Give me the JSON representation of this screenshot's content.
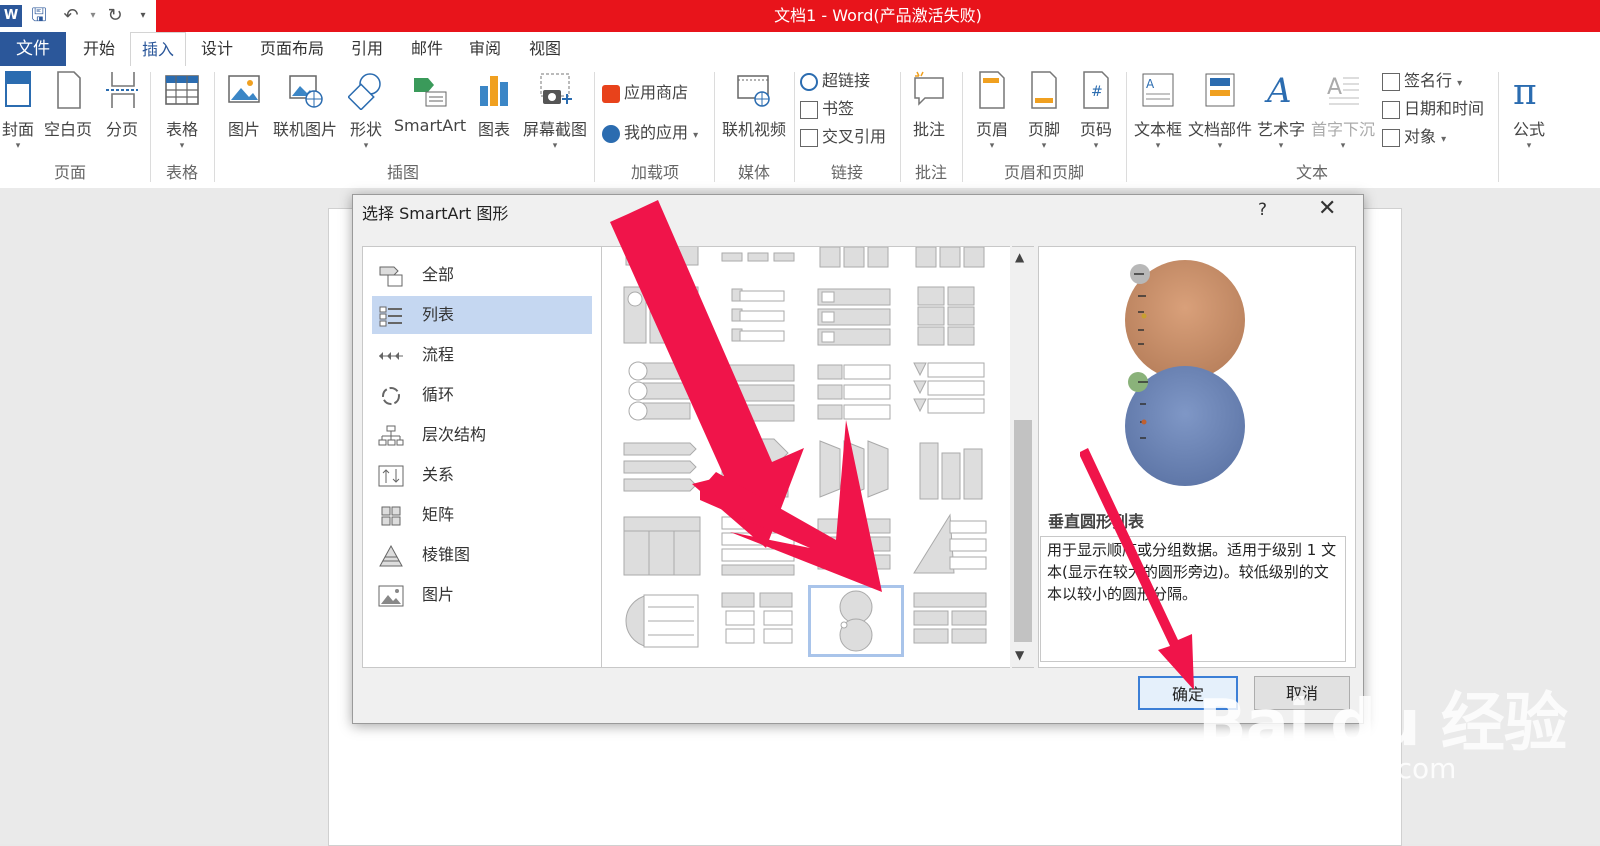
{
  "window": {
    "title": "文档1 -  Word(产品激活失败)"
  },
  "tabs": [
    {
      "label": "文件"
    },
    {
      "label": "开始"
    },
    {
      "label": "插入"
    },
    {
      "label": "设计"
    },
    {
      "label": "页面布局"
    },
    {
      "label": "引用"
    },
    {
      "label": "邮件"
    },
    {
      "label": "审阅"
    },
    {
      "label": "视图"
    }
  ],
  "ribbon": {
    "page": {
      "cover": "封面",
      "blank": "空白页",
      "break": "分页",
      "group": "页面"
    },
    "table": {
      "table": "表格",
      "group": "表格"
    },
    "illus": {
      "picture": "图片",
      "online_picture": "联机图片",
      "shapes": "形状",
      "smartart": "SmartArt",
      "chart": "图表",
      "screenshot": "屏幕截图",
      "group": "插图"
    },
    "addins": {
      "store": "应用商店",
      "myapps": "我的应用",
      "group": "加载项"
    },
    "media": {
      "online_video": "联机视频",
      "group": "媒体"
    },
    "links": {
      "hyperlink": "超链接",
      "bookmark": "书签",
      "crossref": "交叉引用",
      "group": "链接"
    },
    "comments": {
      "comment": "批注",
      "group": "批注"
    },
    "hf": {
      "header": "页眉",
      "footer": "页脚",
      "pagenum": "页码",
      "group": "页眉和页脚"
    },
    "text": {
      "textbox": "文本框",
      "quickparts": "文档部件",
      "wordart": "艺术字",
      "dropcap": "首字下沉",
      "signature": "签名行",
      "datetime": "日期和时间",
      "object": "对象",
      "group": "文本"
    },
    "symbols": {
      "equation": "公式"
    }
  },
  "dialog": {
    "title": "选择 SmartArt 图形",
    "help": "?",
    "close": "✕",
    "categories": [
      {
        "label": "全部"
      },
      {
        "label": "列表"
      },
      {
        "label": "流程"
      },
      {
        "label": "循环"
      },
      {
        "label": "层次结构"
      },
      {
        "label": "关系"
      },
      {
        "label": "矩阵"
      },
      {
        "label": "棱锥图"
      },
      {
        "label": "图片"
      }
    ],
    "selected_category": "列表",
    "preview_name": "垂直圆形列表",
    "preview_desc": "用于显示顺序或分组数据。适用于级别 1 文本(显示在较大的圆形旁边)。较低级别的文本以较小的圆形分隔。",
    "ok": "确定",
    "cancel": "取消"
  },
  "watermark": {
    "brand": "Bai du 经验",
    "url": "jingyan.baidu.com"
  },
  "colors": {
    "title_red": "#e8141b",
    "word_blue": "#2b579a",
    "arrow_red": "#f0144a",
    "select_blue": "#c5d7f1"
  }
}
